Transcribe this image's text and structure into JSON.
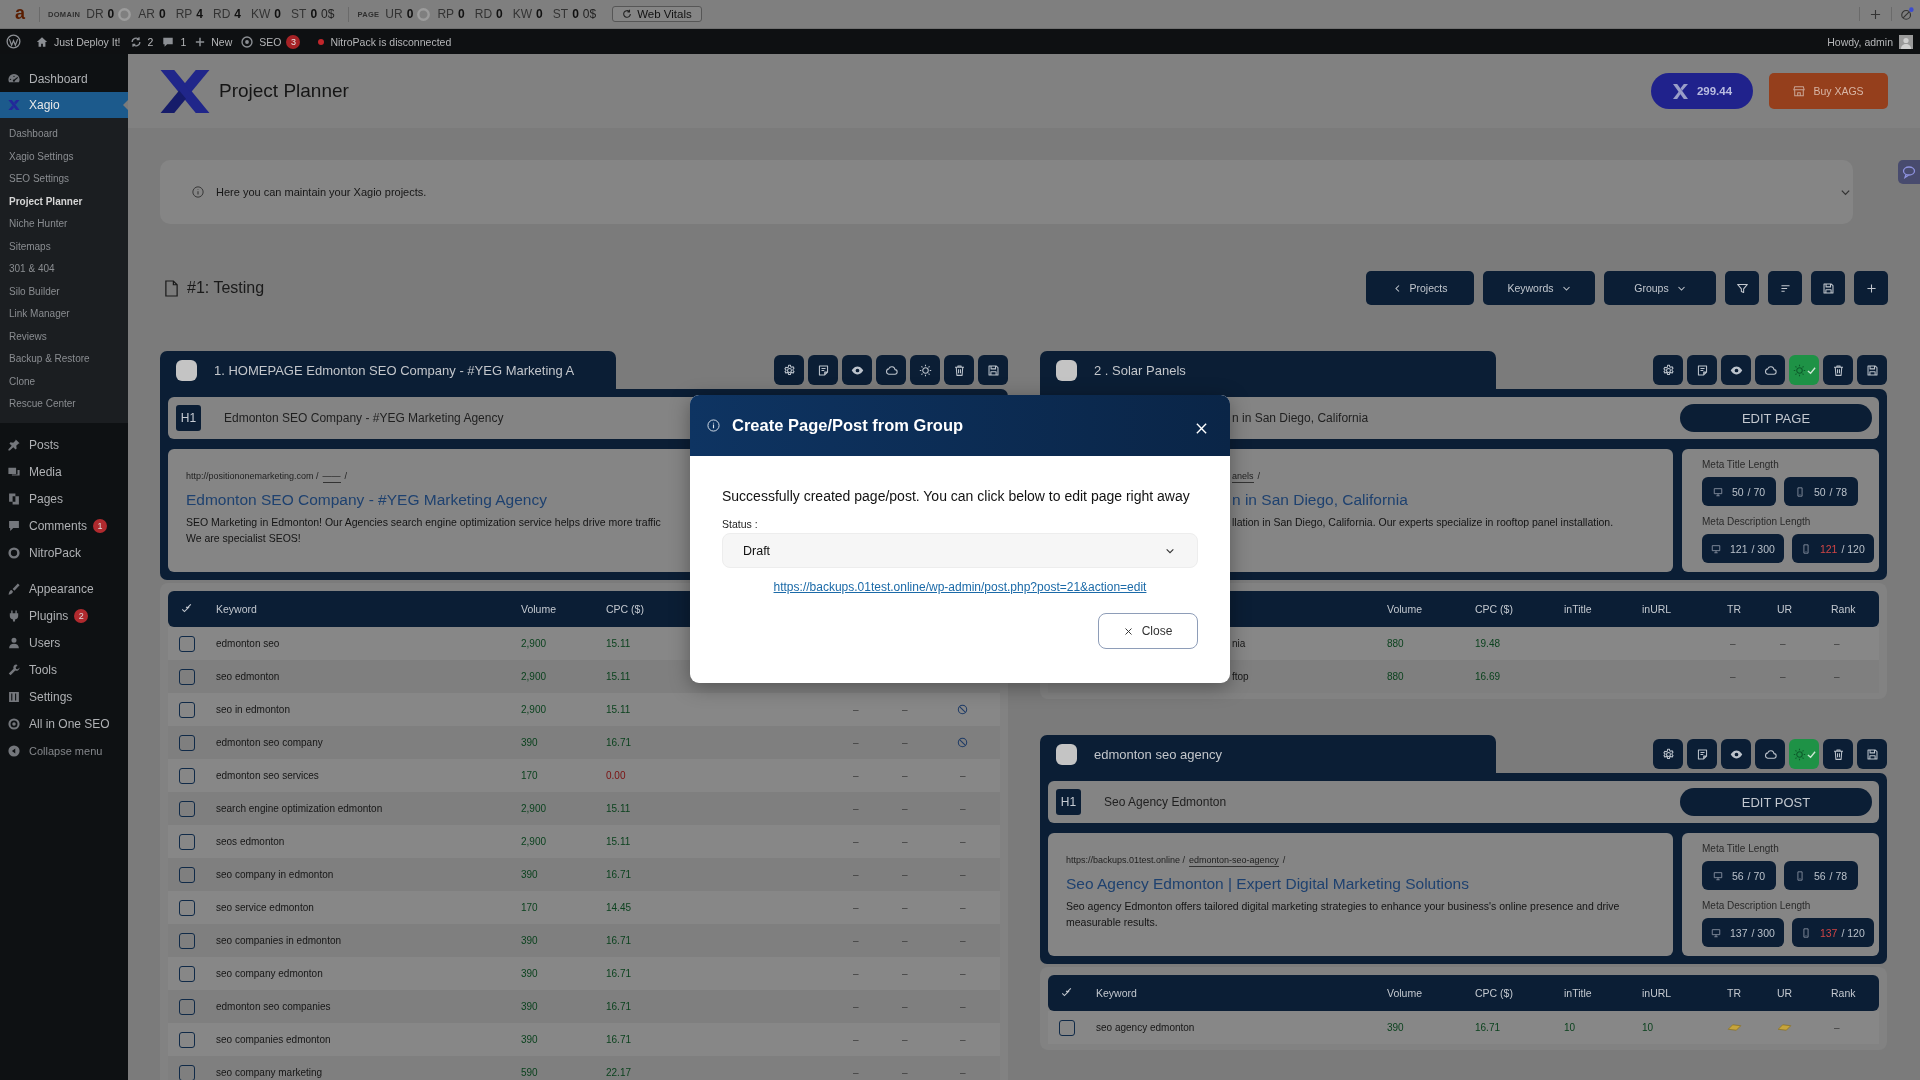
{
  "seo_toolbar": {
    "logo": "a",
    "sections": [
      {
        "label": "DOMAIN",
        "metrics": [
          {
            "kind": "gauge",
            "label": "DR",
            "value": "0"
          },
          {
            "kind": "plain",
            "label": "AR",
            "value": "0"
          },
          {
            "kind": "plain",
            "label": "RP",
            "value": "4"
          },
          {
            "kind": "plain",
            "label": "RD",
            "value": "4"
          },
          {
            "kind": "plain",
            "label": "KW",
            "value": "0"
          },
          {
            "kind": "money",
            "label": "ST",
            "value": "0",
            "extra": "0$"
          }
        ]
      },
      {
        "label": "PAGE",
        "metrics": [
          {
            "kind": "gauge",
            "label": "UR",
            "value": "0"
          },
          {
            "kind": "plain",
            "label": "RP",
            "value": "0"
          },
          {
            "kind": "plain",
            "label": "RD",
            "value": "0"
          },
          {
            "kind": "plain",
            "label": "KW",
            "value": "0"
          },
          {
            "kind": "money",
            "label": "ST",
            "value": "0",
            "extra": "0$"
          }
        ]
      }
    ],
    "web_vitals": "Web Vitals"
  },
  "admin_bar": {
    "site": "Just Deploy It!",
    "updates": "2",
    "comments": "1",
    "new": "New",
    "seo": "SEO",
    "seo_badge": "3",
    "notice": "NitroPack is disconnected",
    "greeting": "Howdy, admin"
  },
  "sidebar": {
    "sections": [
      {
        "items": [
          {
            "kind": "link",
            "label": "Dashboard",
            "selected": false
          },
          {
            "kind": "link",
            "label": "Xagio",
            "selected": true,
            "children": [
              {
                "label": "Dashboard",
                "selected": false
              },
              {
                "label": "Xagio Settings",
                "selected": false
              },
              {
                "label": "SEO Settings",
                "selected": false
              },
              {
                "label": "Project Planner",
                "selected": true
              },
              {
                "label": "Niche Hunter",
                "selected": false
              },
              {
                "label": "Sitemaps",
                "selected": false
              },
              {
                "label": "301 & 404",
                "selected": false
              },
              {
                "label": "Silo Builder",
                "selected": false
              },
              {
                "label": "Link Manager",
                "selected": false
              },
              {
                "label": "Reviews",
                "selected": false
              },
              {
                "label": "Backup & Restore",
                "selected": false
              },
              {
                "label": "Clone",
                "selected": false
              },
              {
                "label": "Rescue Center",
                "selected": false
              }
            ]
          }
        ]
      },
      {
        "items": [
          {
            "kind": "link",
            "label": "Posts",
            "selected": false
          },
          {
            "kind": "link",
            "label": "Media",
            "selected": false
          },
          {
            "kind": "link",
            "label": "Pages",
            "selected": false
          },
          {
            "kind": "link",
            "label": "Comments",
            "selected": false,
            "badge": "1"
          },
          {
            "kind": "link",
            "label": "NitroPack",
            "selected": false
          }
        ]
      },
      {
        "items": [
          {
            "kind": "link",
            "label": "Appearance",
            "selected": false
          },
          {
            "kind": "link",
            "label": "Plugins",
            "selected": false,
            "badge": "2"
          },
          {
            "kind": "link",
            "label": "Users",
            "selected": false
          },
          {
            "kind": "link",
            "label": "Tools",
            "selected": false
          },
          {
            "kind": "link",
            "label": "Settings",
            "selected": false
          },
          {
            "kind": "link",
            "label": "All in One SEO",
            "selected": false
          },
          {
            "kind": "collapse",
            "label": "Collapse menu",
            "selected": false
          }
        ]
      }
    ]
  },
  "header": {
    "title": "Project Planner",
    "balance": "299.44",
    "buy": "Buy XAGS"
  },
  "info_bar": {
    "text": "Here you can maintain your Xagio projects."
  },
  "project": {
    "title": "#1: Testing",
    "toolbar": [
      {
        "kind": "back",
        "label": "Projects"
      },
      {
        "kind": "menu",
        "label": "Keywords"
      },
      {
        "kind": "menu",
        "label": "Groups"
      },
      {
        "kind": "icon"
      },
      {
        "kind": "icon"
      },
      {
        "kind": "icon"
      },
      {
        "kind": "icon"
      }
    ]
  },
  "columns": [
    {
      "groups": [
        {
          "title": "1. HOMEPAGE Edmonton SEO Company - #YEG Marketing A",
          "checked": false,
          "actions": [
            {
              "on": false
            },
            {
              "on": false
            },
            {
              "on": false
            },
            {
              "on": false
            },
            {
              "on": false
            },
            {
              "on": false
            },
            {
              "on": false
            }
          ],
          "h1": {
            "badge": "H1",
            "text": "Edmonton SEO Company - #YEG Marketing Agency"
          },
          "preview": {
            "url": "http://positiononemarketing.com /",
            "slug": "——",
            "slug_end": "/",
            "title": "Edmonton SEO Company - #YEG Marketing Agency",
            "description": [
              "SEO Marketing in Edmonton! Our Agencies search engine optimization service helps drive more traffic",
              "We are specialist SEOS!"
            ]
          },
          "table": {
            "columns": {
              "keyword": "Keyword",
              "volume": "Volume",
              "cpc": "CPC ($)"
            },
            "rows": [
              {
                "checked": false,
                "keyword": "edmonton seo",
                "volume": "2,900",
                "cpc": "15.11",
                "cpc_alert": false
              },
              {
                "checked": false,
                "keyword": "seo edmonton",
                "volume": "2,900",
                "cpc": "15.11",
                "cpc_alert": false
              },
              {
                "checked": false,
                "keyword": "seo in edmonton",
                "volume": "2,900",
                "cpc": "15.11",
                "cpc_alert": false,
                "tr": {
                  "kind": "text",
                  "value": "–"
                },
                "ur": {
                  "kind": "text",
                  "value": "–"
                },
                "rank": {
                  "kind": "icon"
                }
              },
              {
                "checked": false,
                "keyword": "edmonton seo company",
                "volume": "390",
                "cpc": "16.71",
                "cpc_alert": false,
                "tr": {
                  "kind": "text",
                  "value": "–"
                },
                "ur": {
                  "kind": "text",
                  "value": "–"
                },
                "rank": {
                  "kind": "icon"
                }
              },
              {
                "checked": false,
                "keyword": "edmonton seo services",
                "volume": "170",
                "cpc": "0.00",
                "cpc_alert": true,
                "tr": {
                  "kind": "text",
                  "value": "–"
                },
                "ur": {
                  "kind": "text",
                  "value": "–"
                },
                "rank": {
                  "kind": "text",
                  "value": "–"
                }
              },
              {
                "checked": false,
                "keyword": "search engine optimization edmonton",
                "volume": "2,900",
                "cpc": "15.11",
                "cpc_alert": false,
                "tr": {
                  "kind": "text",
                  "value": "–"
                },
                "ur": {
                  "kind": "text",
                  "value": "–"
                },
                "rank": {
                  "kind": "text",
                  "value": "–"
                }
              },
              {
                "checked": false,
                "keyword": "seos edmonton",
                "volume": "2,900",
                "cpc": "15.11",
                "cpc_alert": false,
                "tr": {
                  "kind": "text",
                  "value": "–"
                },
                "ur": {
                  "kind": "text",
                  "value": "–"
                },
                "rank": {
                  "kind": "text",
                  "value": "–"
                }
              },
              {
                "checked": false,
                "keyword": "seo company in edmonton",
                "volume": "390",
                "cpc": "16.71",
                "cpc_alert": false,
                "tr": {
                  "kind": "text",
                  "value": "–"
                },
                "ur": {
                  "kind": "text",
                  "value": "–"
                },
                "rank": {
                  "kind": "text",
                  "value": "–"
                }
              },
              {
                "checked": false,
                "keyword": "seo service edmonton",
                "volume": "170",
                "cpc": "14.45",
                "cpc_alert": false,
                "tr": {
                  "kind": "text",
                  "value": "–"
                },
                "ur": {
                  "kind": "text",
                  "value": "–"
                },
                "rank": {
                  "kind": "text",
                  "value": "–"
                }
              },
              {
                "checked": false,
                "keyword": "seo companies in edmonton",
                "volume": "390",
                "cpc": "16.71",
                "cpc_alert": false,
                "tr": {
                  "kind": "text",
                  "value": "–"
                },
                "ur": {
                  "kind": "text",
                  "value": "–"
                },
                "rank": {
                  "kind": "text",
                  "value": "–"
                }
              },
              {
                "checked": false,
                "keyword": "seo company edmonton",
                "volume": "390",
                "cpc": "16.71",
                "cpc_alert": false,
                "tr": {
                  "kind": "text",
                  "value": "–"
                },
                "ur": {
                  "kind": "text",
                  "value": "–"
                },
                "rank": {
                  "kind": "text",
                  "value": "–"
                }
              },
              {
                "checked": false,
                "keyword": "edmonton seo companies",
                "volume": "390",
                "cpc": "16.71",
                "cpc_alert": false,
                "tr": {
                  "kind": "text",
                  "value": "–"
                },
                "ur": {
                  "kind": "text",
                  "value": "–"
                },
                "rank": {
                  "kind": "text",
                  "value": "–"
                }
              },
              {
                "checked": false,
                "keyword": "seo companies edmonton",
                "volume": "390",
                "cpc": "16.71",
                "cpc_alert": false,
                "tr": {
                  "kind": "text",
                  "value": "–"
                },
                "ur": {
                  "kind": "text",
                  "value": "–"
                },
                "rank": {
                  "kind": "text",
                  "value": "–"
                }
              },
              {
                "checked": false,
                "keyword": "seo company marketing",
                "volume": "590",
                "cpc": "22.17",
                "cpc_alert": false,
                "tr": {
                  "kind": "text",
                  "value": "–"
                },
                "ur": {
                  "kind": "text",
                  "value": "–"
                },
                "rank": {
                  "kind": "text",
                  "value": "–"
                }
              }
            ]
          }
        }
      ]
    },
    {
      "groups": [
        {
          "title": "2 . Solar Panels",
          "checked": false,
          "actions": [
            {
              "on": false
            },
            {
              "on": false
            },
            {
              "on": false
            },
            {
              "on": false
            },
            {
              "on": true
            },
            {
              "on": false
            },
            {
              "on": false
            }
          ],
          "h1": {
            "text": "n in San Diego, California"
          },
          "edit_button": "EDIT PAGE",
          "preview": {
            "slug": "anels",
            "slug_end": "/",
            "title": "n in San Diego, California",
            "description": [
              "llation in San Diego, California. Our experts specialize in rooftop panel installation."
            ]
          },
          "meta": {
            "title_label": "Meta Title Length",
            "title_pills": [
              {
                "count": "50",
                "max": "/ 70",
                "over": false
              },
              {
                "count": "50",
                "max": "/ 78",
                "over": false
              }
            ],
            "description_label": "Meta Description Length",
            "description_pills": [
              {
                "count": "121",
                "max": "/ 300",
                "over": false
              },
              {
                "count": "121",
                "max": "/ 120",
                "over": true
              }
            ]
          },
          "table": {
            "columns": {
              "volume": "Volume",
              "cpc": "CPC ($)",
              "in_title": "inTitle",
              "in_url": "inURL",
              "tr": "TR",
              "ur": "UR",
              "rank": "Rank"
            },
            "rows": [
              {
                "keyword": "nia",
                "volume": "880",
                "cpc": "19.48",
                "cpc_alert": false,
                "tr": {
                  "kind": "text",
                  "value": "–"
                },
                "ur": {
                  "kind": "text",
                  "value": "–"
                },
                "rank": {
                  "kind": "text",
                  "value": "–"
                }
              },
              {
                "keyword": "ftop",
                "volume": "880",
                "cpc": "16.69",
                "cpc_alert": false,
                "tr": {
                  "kind": "text",
                  "value": "–"
                },
                "ur": {
                  "kind": "text",
                  "value": "–"
                },
                "rank": {
                  "kind": "text",
                  "value": "–"
                }
              }
            ]
          }
        },
        {
          "title": "edmonton seo agency",
          "checked": false,
          "actions": [
            {
              "on": false
            },
            {
              "on": false
            },
            {
              "on": false
            },
            {
              "on": false
            },
            {
              "on": true
            },
            {
              "on": false
            },
            {
              "on": false
            }
          ],
          "h1": {
            "badge": "H1",
            "text": "Seo Agency Edmonton"
          },
          "edit_button": "EDIT POST",
          "preview": {
            "url": "https://backups.01test.online /",
            "slug": "edmonton-seo-agency",
            "slug_end": "/",
            "title": "Seo Agency Edmonton | Expert Digital Marketing Solutions",
            "description": [
              "Seo agency Edmonton offers tailored digital marketing strategies to enhance your business's online presence and drive",
              "measurable results."
            ]
          },
          "meta": {
            "title_label": "Meta Title Length",
            "title_pills": [
              {
                "count": "56",
                "max": "/ 70",
                "over": false
              },
              {
                "count": "56",
                "max": "/ 78",
                "over": false
              }
            ],
            "description_label": "Meta Description Length",
            "description_pills": [
              {
                "count": "137",
                "max": "/ 300",
                "over": false
              },
              {
                "count": "137",
                "max": "/ 120",
                "over": true
              }
            ]
          },
          "table": {
            "columns": {
              "keyword": "Keyword",
              "volume": "Volume",
              "cpc": "CPC ($)",
              "in_title": "inTitle",
              "in_url": "inURL",
              "tr": "TR",
              "ur": "UR",
              "rank": "Rank"
            },
            "rows": [
              {
                "checked": false,
                "keyword": "seo agency edmonton",
                "volume": "390",
                "cpc": "16.71",
                "cpc_alert": false,
                "in_title": "10",
                "in_url": "10",
                "tr": {
                  "kind": "icon"
                },
                "ur": {
                  "kind": "icon"
                },
                "rank": {
                  "kind": "text",
                  "value": "–"
                }
              }
            ]
          }
        }
      ]
    }
  ],
  "modal": {
    "title": "Create Page/Post from Group",
    "message": "Successfully created page/post. You can click below to edit page right away",
    "status_label": "Status :",
    "status_value": "Draft",
    "link": "https://backups.01test.online/wp-admin/post.php?post=21&action=edit",
    "close": "Close"
  }
}
